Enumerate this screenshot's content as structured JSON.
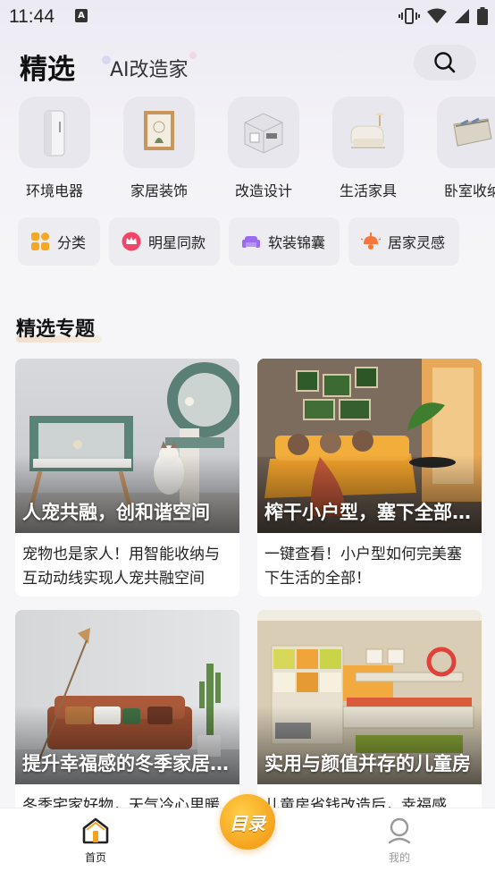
{
  "status_bar": {
    "time": "11:44",
    "notif_letter": "A"
  },
  "header": {
    "tab_selected": "精选",
    "tab_other": "AI改造家"
  },
  "categories": [
    {
      "label": "环境电器",
      "icon": "air-purifier-icon"
    },
    {
      "label": "家居装饰",
      "icon": "picture-frame-icon"
    },
    {
      "label": "改造设计",
      "icon": "room-model-icon"
    },
    {
      "label": "生活家具",
      "icon": "lounge-chair-icon"
    },
    {
      "label": "卧室收纳",
      "icon": "storage-box-icon"
    }
  ],
  "chips": [
    {
      "label": "分类",
      "icon": "grid-icon",
      "color": "#f7a823"
    },
    {
      "label": "明星同款",
      "icon": "crown-icon",
      "color": "#f2456a"
    },
    {
      "label": "软装锦囊",
      "icon": "sofa-icon",
      "color": "#9b6cf0"
    },
    {
      "label": "居家灵感",
      "icon": "lamp-icon",
      "color": "#f7763a"
    }
  ],
  "section": {
    "title": "精选专题"
  },
  "cards": [
    {
      "title": "人宠共融，创和谐空间",
      "desc": "宠物也是家人！用智能收纳与互动动线实现人宠共融空间"
    },
    {
      "title": "榨干小户型，塞下全部生活",
      "desc": "一键查看！小户型如何完美塞下生活的全部！"
    },
    {
      "title": "提升幸福感的冬季家居好物",
      "desc": "冬季宅家好物，天气冷心里暖"
    },
    {
      "title": "实用与颜值并存的儿童房",
      "desc": "儿童房省钱改造后，幸福感"
    }
  ],
  "bottom_nav": {
    "home_label": "首页",
    "center_label": "目录",
    "mine_label": "我的"
  },
  "colors": {
    "accent": "#f6a21c",
    "nav_active": "#222222",
    "nav_inactive": "#999999"
  }
}
